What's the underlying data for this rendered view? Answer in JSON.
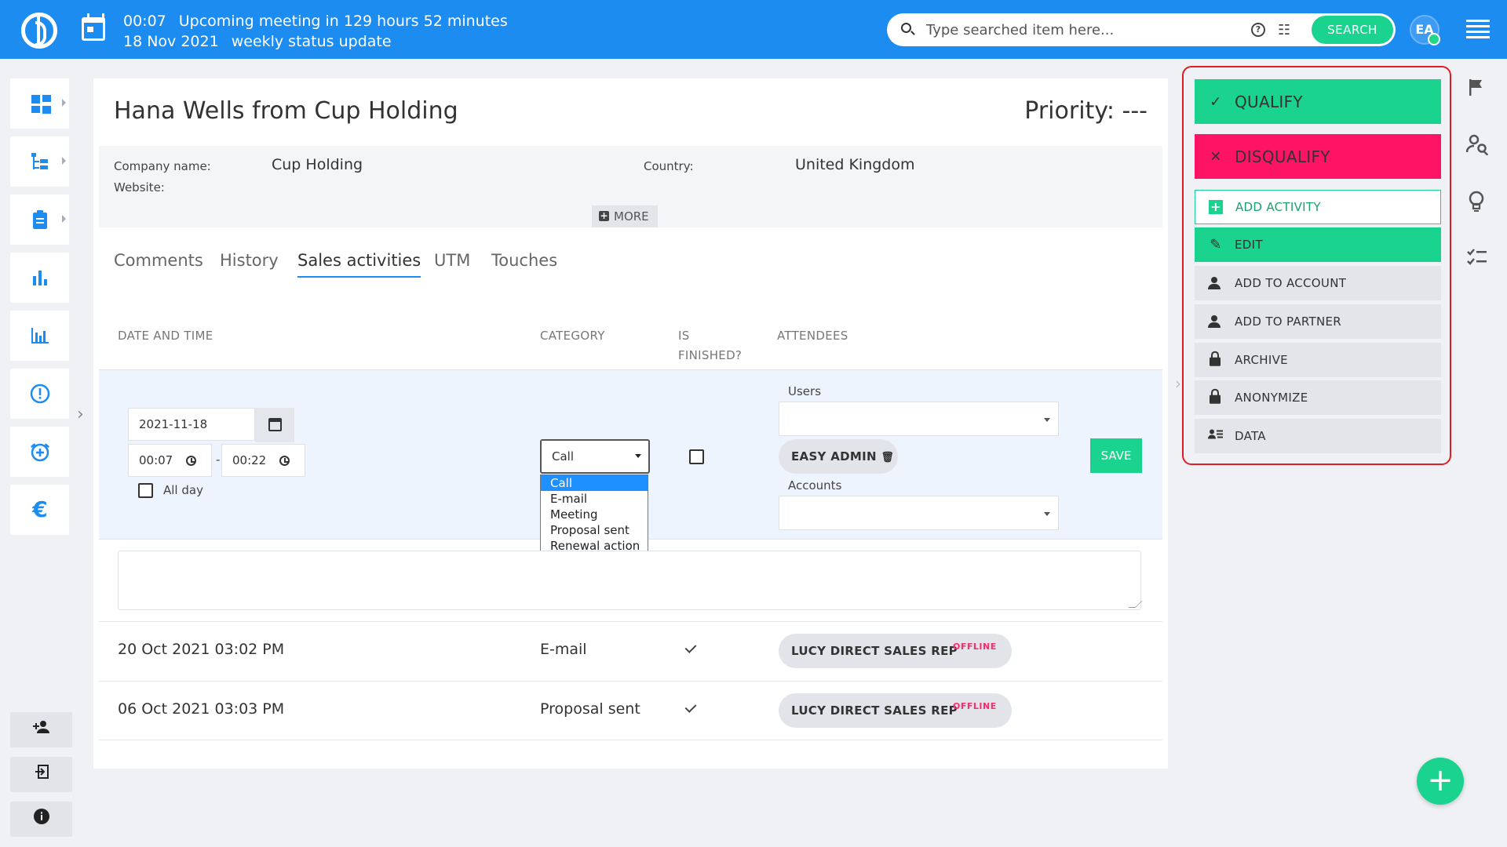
{
  "topbar": {
    "time": "00:07",
    "meeting_text": "Upcoming meeting in 129 hours 52 minutes",
    "date": "18 Nov 2021",
    "meeting_name": "weekly status update",
    "search_placeholder": "Type searched item here...",
    "search_button": "SEARCH",
    "avatar_initials": "EA"
  },
  "lead": {
    "title": "Hana Wells from Cup Holding",
    "priority": "Priority: ---",
    "company_label": "Company name:",
    "company_value": "Cup Holding",
    "website_label": "Website:",
    "country_label": "Country:",
    "country_value": "United Kingdom",
    "more_label": "MORE"
  },
  "tabs": [
    "Comments",
    "History",
    "Sales activities",
    "UTM",
    "Touches"
  ],
  "active_tab": "Sales activities",
  "table": {
    "headers": {
      "date": "DATE AND TIME",
      "category": "CATEGORY",
      "finished_1": "IS",
      "finished_2": "FINISHED?",
      "attendees": "ATTENDEES"
    },
    "new_row": {
      "date": "2021-11-18",
      "time_from": "00:07",
      "separator": "-",
      "time_to": "00:22",
      "all_day_label": "All day",
      "category_selected": "Call",
      "category_options": [
        "Call",
        "E-mail",
        "Meeting",
        "Proposal sent",
        "Renewal action"
      ],
      "users_label": "Users",
      "user_chip": "EASY ADMIN",
      "accounts_label": "Accounts",
      "save_label": "SAVE"
    },
    "rows": [
      {
        "date": "20 Oct 2021 03:02 PM",
        "category": "E-mail",
        "attendee": "LUCY DIRECT SALES REP",
        "status": "OFFLINE"
      },
      {
        "date": "06 Oct 2021 03:03 PM",
        "category": "Proposal sent",
        "attendee": "LUCY DIRECT SALES REP",
        "status": "OFFLINE"
      }
    ]
  },
  "actions": {
    "qualify": "QUALIFY",
    "disqualify": "DISQUALIFY",
    "add_activity": "ADD ACTIVITY",
    "edit": "EDIT",
    "add_to_account": "ADD TO ACCOUNT",
    "add_to_partner": "ADD TO PARTNER",
    "archive": "ARCHIVE",
    "anonymize": "ANONYMIZE",
    "data": "DATA"
  },
  "colors": {
    "brand_blue": "#1c8cf0",
    "green": "#19d38f",
    "pink": "#ff1465",
    "highlight_red": "#e31b23"
  },
  "icons": {
    "sidebar": [
      "dashboard-icon",
      "tree-icon",
      "clipboard-icon",
      "bar-chart-icon",
      "stats-icon",
      "alert-icon",
      "alarm-icon",
      "euro-icon"
    ],
    "sidebar_bottom": [
      "add-user-icon",
      "logout-icon",
      "info-icon"
    ],
    "right_rail": [
      "flag-icon",
      "person-search-icon",
      "lightbulb-icon",
      "checklist-icon"
    ]
  }
}
